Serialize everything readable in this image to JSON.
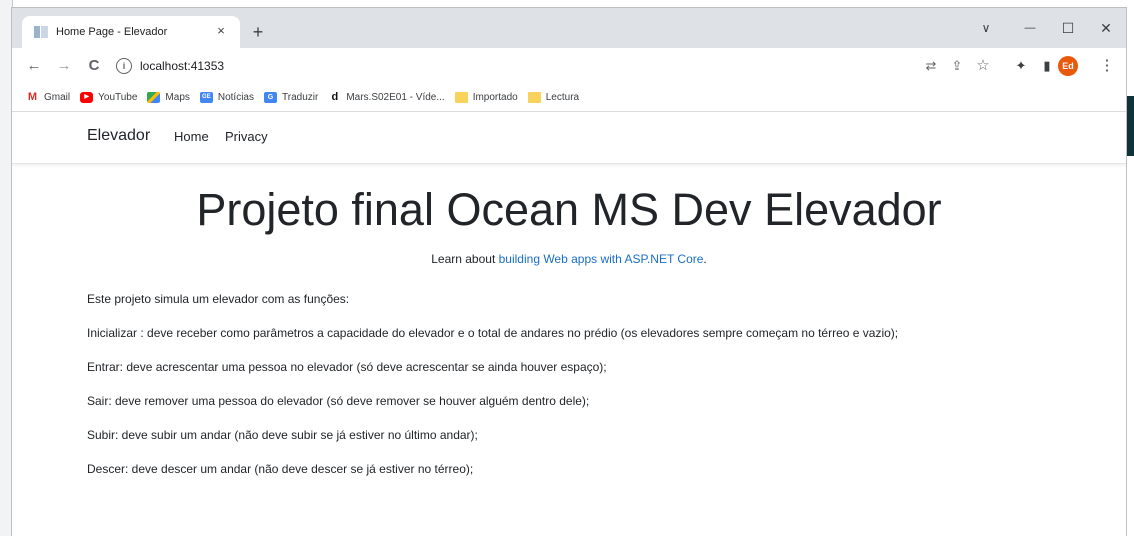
{
  "browser": {
    "tab_title": "Home Page - Elevador",
    "tab_close": "×",
    "new_tab": "+",
    "window_controls": {
      "dropdown": "∨",
      "minimize": "—",
      "maximize": "☐",
      "close": "✕"
    },
    "nav": {
      "back": "←",
      "forward": "→",
      "reload": "C",
      "info": "i"
    },
    "url": "localhost:41353",
    "toolbar_icons": {
      "translate": "⇄",
      "share": "⇪",
      "bookmark": "☆",
      "extensions": "✦",
      "sidepanel": "▮",
      "menu": "⋮"
    },
    "profile_initials": "Ed",
    "bookmarks": [
      {
        "label": "Gmail",
        "icon": "gmail-icon",
        "glyph": "M"
      },
      {
        "label": "YouTube",
        "icon": "youtube-icon",
        "glyph": "▶"
      },
      {
        "label": "Maps",
        "icon": "maps-icon",
        "glyph": ""
      },
      {
        "label": "Notícias",
        "icon": "news-icon",
        "glyph": "GE"
      },
      {
        "label": "Traduzir",
        "icon": "translate-icon",
        "glyph": "G"
      },
      {
        "label": "Mars.S02E01 - Víde...",
        "icon": "d-icon",
        "glyph": "d"
      },
      {
        "label": "Importado",
        "icon": "folder-icon",
        "glyph": ""
      },
      {
        "label": "Lectura",
        "icon": "folder-icon",
        "glyph": ""
      }
    ]
  },
  "site": {
    "brand": "Elevador",
    "nav_links": [
      "Home",
      "Privacy"
    ],
    "title": "Projeto final Ocean MS Dev Elevador",
    "learn_prefix": "Learn about ",
    "learn_link": "building Web apps with ASP.NET Core",
    "learn_suffix": ".",
    "paragraphs": [
      "Este projeto simula um elevador com as funções:",
      "Inicializar : deve receber como parâmetros a capacidade do elevador e o total de andares no prédio (os elevadores sempre começam no térreo e vazio);",
      "Entrar: deve acrescentar uma pessoa no elevador (só deve acrescentar se ainda houver espaço);",
      "Sair: deve remover uma pessoa do elevador (só deve remover se houver alguém dentro dele);",
      "Subir: deve subir um andar (não deve subir se já estiver no último andar);",
      "Descer: deve descer um andar (não deve descer se já estiver no térreo);"
    ]
  },
  "colors": {
    "link": "#1b6ec2",
    "text": "#212529",
    "chrome_frame": "#dee1e6",
    "avatar": "#e8590c"
  }
}
